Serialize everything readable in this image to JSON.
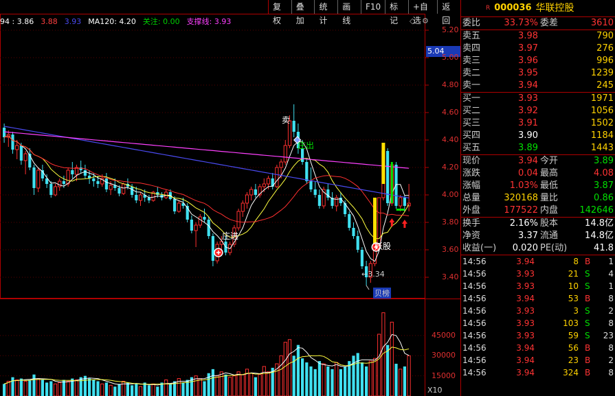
{
  "toolbar": {
    "items": [
      "复权",
      "叠加",
      "统计",
      "画线",
      "F10",
      "标记",
      "+自选",
      "返回"
    ]
  },
  "ma_legend": [
    {
      "text": "94 : 3.86",
      "color": "#ffffff"
    },
    {
      "text": "3.88",
      "color": "#ff4040"
    },
    {
      "text": "3.93",
      "color": "#4a4af0"
    },
    {
      "text": "MA120: 4.20",
      "color": "#ffffff"
    },
    {
      "text": "关注: 0.00",
      "color": "#00d000"
    },
    {
      "text": "支撑线: 3.93",
      "color": "#ff40ff"
    }
  ],
  "corner_icons": {
    "diamond": "◇",
    "gear": "⚙"
  },
  "price_tag": "5.04",
  "price_axis": [
    "5.20",
    "5.00",
    "4.80",
    "4.60",
    "4.40",
    "4.20",
    "4.00",
    "3.80",
    "3.60",
    "3.40"
  ],
  "volume_axis": [
    "45000",
    "30000",
    "15000"
  ],
  "volume_unit": "X10",
  "annotations": {
    "sell": "卖",
    "zhuang_out": "庄出",
    "zhuang_in": "庄进",
    "yao_stock": "妖股",
    "low_marker": "←3.34",
    "rank_tag": "贝榜"
  },
  "chart_data": {
    "type": "candlestick",
    "price_range": [
      3.26,
      5.32
    ],
    "candles": [
      [
        4.49,
        4.52,
        4.38,
        4.42
      ],
      [
        4.42,
        4.47,
        4.35,
        4.44
      ],
      [
        4.44,
        4.46,
        4.3,
        4.33
      ],
      [
        4.33,
        4.4,
        4.26,
        4.36
      ],
      [
        4.36,
        4.38,
        4.22,
        4.25
      ],
      [
        4.25,
        4.32,
        4.15,
        4.3
      ],
      [
        4.3,
        4.34,
        4.18,
        4.2
      ],
      [
        4.2,
        4.22,
        4.0,
        4.05
      ],
      [
        4.05,
        4.2,
        4.02,
        4.18
      ],
      [
        4.18,
        4.22,
        4.1,
        4.12
      ],
      [
        4.12,
        4.15,
        4.05,
        4.08
      ],
      [
        4.08,
        4.1,
        3.98,
        4.0
      ],
      [
        4.0,
        4.08,
        3.99,
        4.06
      ],
      [
        4.06,
        4.12,
        4.03,
        4.1
      ],
      [
        4.1,
        4.14,
        4.05,
        4.08
      ],
      [
        4.08,
        4.2,
        4.06,
        4.18
      ],
      [
        4.18,
        4.24,
        4.12,
        4.15
      ],
      [
        4.15,
        4.22,
        4.1,
        4.2
      ],
      [
        4.2,
        4.25,
        4.16,
        4.18
      ],
      [
        4.18,
        4.22,
        4.12,
        4.14
      ],
      [
        4.14,
        4.18,
        4.08,
        4.12
      ],
      [
        4.12,
        4.16,
        4.06,
        4.1
      ],
      [
        4.1,
        4.14,
        4.05,
        4.08
      ],
      [
        4.08,
        4.15,
        4.06,
        4.12
      ],
      [
        4.12,
        4.16,
        4.02,
        4.04
      ],
      [
        4.04,
        4.1,
        4.0,
        4.07
      ],
      [
        4.07,
        4.12,
        4.03,
        4.05
      ],
      [
        4.05,
        4.07,
        3.99,
        4.01
      ],
      [
        4.01,
        4.09,
        4.0,
        4.08
      ],
      [
        4.08,
        4.12,
        4.04,
        4.06
      ],
      [
        4.06,
        4.08,
        3.98,
        4.0
      ],
      [
        4.0,
        4.06,
        3.94,
        3.96
      ],
      [
        3.96,
        4.02,
        3.92,
        4.0
      ],
      [
        4.0,
        4.04,
        3.95,
        3.98
      ],
      [
        3.98,
        4.0,
        3.94,
        3.96
      ],
      [
        3.96,
        4.03,
        3.95,
        4.02
      ],
      [
        4.02,
        4.06,
        3.98,
        4.0
      ],
      [
        4.0,
        4.02,
        3.96,
        3.98
      ],
      [
        3.98,
        4.04,
        3.97,
        4.02
      ],
      [
        4.02,
        4.04,
        3.96,
        3.97
      ],
      [
        3.97,
        3.99,
        3.86,
        3.88
      ],
      [
        3.88,
        3.96,
        3.87,
        3.94
      ],
      [
        3.94,
        3.98,
        3.9,
        3.92
      ],
      [
        3.92,
        3.94,
        3.8,
        3.82
      ],
      [
        3.82,
        3.85,
        3.72,
        3.74
      ],
      [
        3.74,
        3.8,
        3.62,
        3.78
      ],
      [
        3.78,
        3.86,
        3.76,
        3.84
      ],
      [
        3.84,
        3.9,
        3.8,
        3.82
      ],
      [
        3.82,
        3.84,
        3.68,
        3.7
      ],
      [
        3.7,
        3.72,
        3.48,
        3.52
      ],
      [
        3.52,
        3.66,
        3.5,
        3.64
      ],
      [
        3.64,
        3.7,
        3.6,
        3.66
      ],
      [
        3.66,
        3.7,
        3.56,
        3.58
      ],
      [
        3.58,
        3.66,
        3.56,
        3.64
      ],
      [
        3.64,
        3.78,
        3.62,
        3.76
      ],
      [
        3.76,
        3.9,
        3.74,
        3.88
      ],
      [
        3.88,
        3.96,
        3.84,
        3.94
      ],
      [
        3.94,
        4.02,
        3.9,
        4.0
      ],
      [
        4.0,
        4.06,
        3.96,
        4.04
      ],
      [
        4.04,
        4.08,
        3.98,
        4.0
      ],
      [
        4.0,
        4.08,
        3.98,
        4.06
      ],
      [
        4.06,
        4.12,
        4.02,
        4.08
      ],
      [
        4.08,
        4.14,
        4.04,
        4.12
      ],
      [
        4.12,
        4.16,
        4.04,
        4.06
      ],
      [
        4.06,
        4.22,
        4.05,
        4.2
      ],
      [
        4.2,
        4.26,
        4.12,
        4.24
      ],
      [
        4.24,
        4.4,
        4.22,
        4.36
      ],
      [
        4.36,
        4.58,
        4.34,
        4.54
      ],
      [
        4.54,
        4.66,
        4.42,
        4.46
      ],
      [
        4.46,
        4.52,
        4.3,
        4.34
      ],
      [
        4.34,
        4.4,
        4.22,
        4.24
      ],
      [
        4.24,
        4.26,
        4.08,
        4.1
      ],
      [
        4.1,
        4.2,
        4.02,
        4.04
      ],
      [
        4.04,
        4.1,
        3.98,
        4.0
      ],
      [
        4.0,
        4.04,
        3.9,
        3.92
      ],
      [
        3.92,
        4.06,
        3.9,
        4.04
      ],
      [
        4.04,
        4.08,
        3.96,
        3.98
      ],
      [
        3.98,
        4.02,
        3.9,
        3.92
      ],
      [
        3.92,
        4.0,
        3.88,
        3.98
      ],
      [
        3.98,
        4.02,
        3.92,
        3.94
      ],
      [
        3.94,
        3.96,
        3.84,
        3.86
      ],
      [
        3.86,
        3.88,
        3.74,
        3.76
      ],
      [
        3.76,
        3.8,
        3.68,
        3.7
      ],
      [
        3.7,
        3.74,
        3.58,
        3.6
      ],
      [
        3.6,
        3.62,
        3.46,
        3.48
      ],
      [
        3.48,
        3.52,
        3.34,
        3.4
      ],
      [
        3.4,
        3.52,
        3.36,
        3.5
      ],
      [
        3.5,
        3.62,
        3.48,
        3.6
      ],
      [
        3.62,
        3.98,
        3.62,
        3.98
      ],
      [
        3.98,
        4.38,
        3.96,
        4.32
      ],
      [
        4.32,
        4.34,
        3.92,
        3.94
      ],
      [
        3.94,
        4.24,
        3.92,
        4.22
      ],
      [
        4.22,
        4.24,
        3.9,
        3.92
      ],
      [
        3.92,
        4.0,
        3.88,
        3.98
      ],
      [
        3.98,
        4.0,
        3.88,
        3.92
      ],
      [
        3.92,
        4.08,
        3.88,
        3.94
      ]
    ],
    "volumes": [
      9000,
      11000,
      14000,
      12000,
      13000,
      11000,
      12000,
      16000,
      13000,
      12000,
      10000,
      11000,
      9000,
      10000,
      12000,
      11000,
      13000,
      12000,
      14000,
      15000,
      13000,
      12000,
      11000,
      9000,
      10000,
      8000,
      7000,
      9000,
      11000,
      10000,
      8000,
      9000,
      7000,
      10000,
      8000,
      9000,
      7000,
      10000,
      12000,
      9000,
      11000,
      13000,
      10000,
      12000,
      14000,
      15000,
      13000,
      11000,
      17000,
      20000,
      15000,
      18000,
      16000,
      14000,
      15000,
      18000,
      16000,
      20000,
      17000,
      14000,
      16000,
      22000,
      18000,
      21000,
      24000,
      30000,
      40000,
      42000,
      30000,
      38000,
      28000,
      25000,
      22000,
      20000,
      26000,
      24000,
      22000,
      20000,
      25000,
      20000,
      22000,
      26000,
      30000,
      32000,
      25000,
      22000,
      26000,
      28000,
      46000,
      62000,
      38000,
      55000,
      24000,
      20000,
      22000,
      30000
    ]
  },
  "quote": {
    "code": "000036",
    "name": "华联控股",
    "r_mark": "R",
    "weibi": {
      "label": "委比",
      "value": "33.73%",
      "label2": "委差",
      "value2": "3610"
    },
    "sells": [
      {
        "label": "卖五",
        "price": "3.98",
        "vol": "790"
      },
      {
        "label": "卖四",
        "price": "3.97",
        "vol": "276"
      },
      {
        "label": "卖三",
        "price": "3.96",
        "vol": "996"
      },
      {
        "label": "卖二",
        "price": "3.95",
        "vol": "1239"
      },
      {
        "label": "卖一",
        "price": "3.94",
        "vol": "245"
      }
    ],
    "buys": [
      {
        "label": "买一",
        "price": "3.93",
        "vol": "1971",
        "color": "red"
      },
      {
        "label": "买二",
        "price": "3.92",
        "vol": "1056",
        "color": "red"
      },
      {
        "label": "买三",
        "price": "3.91",
        "vol": "1502",
        "color": "red"
      },
      {
        "label": "买四",
        "price": "3.90",
        "vol": "1184",
        "color": "white"
      },
      {
        "label": "买五",
        "price": "3.89",
        "vol": "1443",
        "color": "green"
      }
    ],
    "stats1": [
      {
        "l1": "现价",
        "v1": "3.94",
        "c1": "red",
        "l2": "今开",
        "v2": "3.89",
        "c2": "green"
      },
      {
        "l1": "涨跌",
        "v1": "0.04",
        "c1": "red",
        "l2": "最高",
        "v2": "4.08",
        "c2": "red"
      },
      {
        "l1": "涨幅",
        "v1": "1.03%",
        "c1": "red",
        "l2": "最低",
        "v2": "3.87",
        "c2": "green"
      },
      {
        "l1": "总量",
        "v1": "320168",
        "c1": "yellow",
        "l2": "量比",
        "v2": "0.86",
        "c2": "green"
      },
      {
        "l1": "外盘",
        "v1": "177522",
        "c1": "red",
        "l2": "内盘",
        "v2": "142646",
        "c2": "green"
      }
    ],
    "stats2": [
      {
        "l1": "换手",
        "v1": "2.16%",
        "c1": "white",
        "l2": "股本",
        "v2": "14.8亿",
        "c2": "white"
      },
      {
        "l1": "净资",
        "v1": "3.37",
        "c1": "white",
        "l2": "流通",
        "v2": "14.8亿",
        "c2": "white"
      },
      {
        "l1": "收益(一)",
        "v1": "0.020",
        "c1": "white",
        "l2": "PE(动)",
        "v2": "41.8",
        "c2": "white"
      }
    ],
    "ticks": [
      {
        "time": "14:56",
        "price": "3.94",
        "vol": "8",
        "bs": "B",
        "n": "1"
      },
      {
        "time": "14:56",
        "price": "3.93",
        "vol": "21",
        "bs": "S",
        "n": "4"
      },
      {
        "time": "14:56",
        "price": "3.93",
        "vol": "10",
        "bs": "S",
        "n": "1"
      },
      {
        "time": "14:56",
        "price": "3.94",
        "vol": "53",
        "bs": "B",
        "n": "8"
      },
      {
        "time": "14:56",
        "price": "3.93",
        "vol": "3",
        "bs": "S",
        "n": "2"
      },
      {
        "time": "14:56",
        "price": "3.93",
        "vol": "103",
        "bs": "S",
        "n": "8"
      },
      {
        "time": "14:56",
        "price": "3.93",
        "vol": "59",
        "bs": "S",
        "n": "23"
      },
      {
        "time": "14:56",
        "price": "3.94",
        "vol": "56",
        "bs": "B",
        "n": "8"
      },
      {
        "time": "14:56",
        "price": "3.94",
        "vol": "23",
        "bs": "B",
        "n": "2"
      },
      {
        "time": "14:56",
        "price": "3.94",
        "vol": "324",
        "bs": "B",
        "n": "8"
      }
    ]
  }
}
